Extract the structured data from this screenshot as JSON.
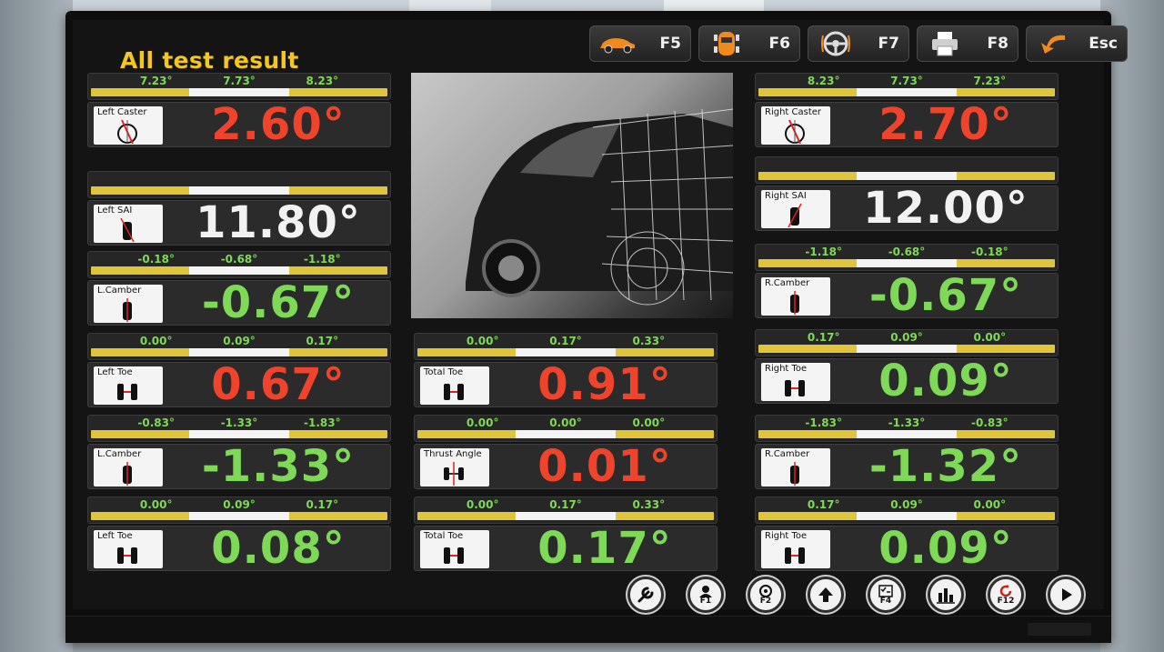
{
  "app": {
    "title": "All test result"
  },
  "toolbar": {
    "fkeys": [
      {
        "label": "F5",
        "icon": "car-side-icon"
      },
      {
        "label": "F6",
        "icon": "car-top-icon"
      },
      {
        "label": "F7",
        "icon": "steering-wheel-icon"
      },
      {
        "label": "F8",
        "icon": "printer-icon"
      },
      {
        "label": "Esc",
        "icon": "back-arrow-icon"
      }
    ]
  },
  "colors": {
    "red": "#f0432b",
    "green": "#7ed957",
    "white": "#f2f2f2",
    "title": "#f4c620",
    "tolerance": "#e0c43a"
  },
  "cards": {
    "left_caster": {
      "label": "Left Caster",
      "ticks": [
        "7.23°",
        "7.73°",
        "8.23°"
      ],
      "value": "2.60°",
      "color": "red"
    },
    "left_sai": {
      "label": "Left SAI",
      "ticks": [
        "",
        "",
        ""
      ],
      "value": "11.80°",
      "color": "white"
    },
    "l_camber_1": {
      "label": "L.Camber",
      "ticks": [
        "-0.18°",
        "-0.68°",
        "-1.18°"
      ],
      "value": "-0.67°",
      "color": "green"
    },
    "left_toe_1": {
      "label": "Left Toe",
      "ticks": [
        "0.00°",
        "0.09°",
        "0.17°"
      ],
      "value": "0.67°",
      "color": "red"
    },
    "l_camber_2": {
      "label": "L.Camber",
      "ticks": [
        "-0.83°",
        "-1.33°",
        "-1.83°"
      ],
      "value": "-1.33°",
      "color": "green"
    },
    "left_toe_2": {
      "label": "Left Toe",
      "ticks": [
        "0.00°",
        "0.09°",
        "0.17°"
      ],
      "value": "0.08°",
      "color": "green"
    },
    "total_toe_1": {
      "label": "Total Toe",
      "ticks": [
        "0.00°",
        "0.17°",
        "0.33°"
      ],
      "value": "0.91°",
      "color": "red"
    },
    "thrust_angle": {
      "label": "Thrust Angle",
      "ticks": [
        "0.00°",
        "0.00°",
        "0.00°"
      ],
      "value": "0.01°",
      "color": "red"
    },
    "total_toe_2": {
      "label": "Total Toe",
      "ticks": [
        "0.00°",
        "0.17°",
        "0.33°"
      ],
      "value": "0.17°",
      "color": "green"
    },
    "right_caster": {
      "label": "Right Caster",
      "ticks": [
        "8.23°",
        "7.73°",
        "7.23°"
      ],
      "value": "2.70°",
      "color": "red"
    },
    "right_sai": {
      "label": "Right SAI",
      "ticks": [
        "",
        "",
        ""
      ],
      "value": "12.00°",
      "color": "white"
    },
    "r_camber_1": {
      "label": "R.Camber",
      "ticks": [
        "-1.18°",
        "-0.68°",
        "-0.18°"
      ],
      "value": "-0.67°",
      "color": "green"
    },
    "right_toe_1": {
      "label": "Right Toe",
      "ticks": [
        "0.17°",
        "0.09°",
        "0.00°"
      ],
      "value": "0.09°",
      "color": "green"
    },
    "r_camber_2": {
      "label": "R.Camber",
      "ticks": [
        "-1.83°",
        "-1.33°",
        "-0.83°"
      ],
      "value": "-1.32°",
      "color": "green"
    },
    "right_toe_2": {
      "label": "Right Toe",
      "ticks": [
        "0.17°",
        "0.09°",
        "0.00°"
      ],
      "value": "0.09°",
      "color": "green"
    }
  },
  "bottom_nav": [
    {
      "key": "",
      "icon": "wrench-icon"
    },
    {
      "key": "F1",
      "icon": "user-icon"
    },
    {
      "key": "F2",
      "icon": "target-icon"
    },
    {
      "key": "",
      "icon": "upload-arrow-icon"
    },
    {
      "key": "F4",
      "icon": "checklist-icon"
    },
    {
      "key": "",
      "icon": "bar-chart-icon"
    },
    {
      "key": "F12",
      "icon": "refresh-icon"
    },
    {
      "key": "",
      "icon": "play-icon"
    }
  ]
}
